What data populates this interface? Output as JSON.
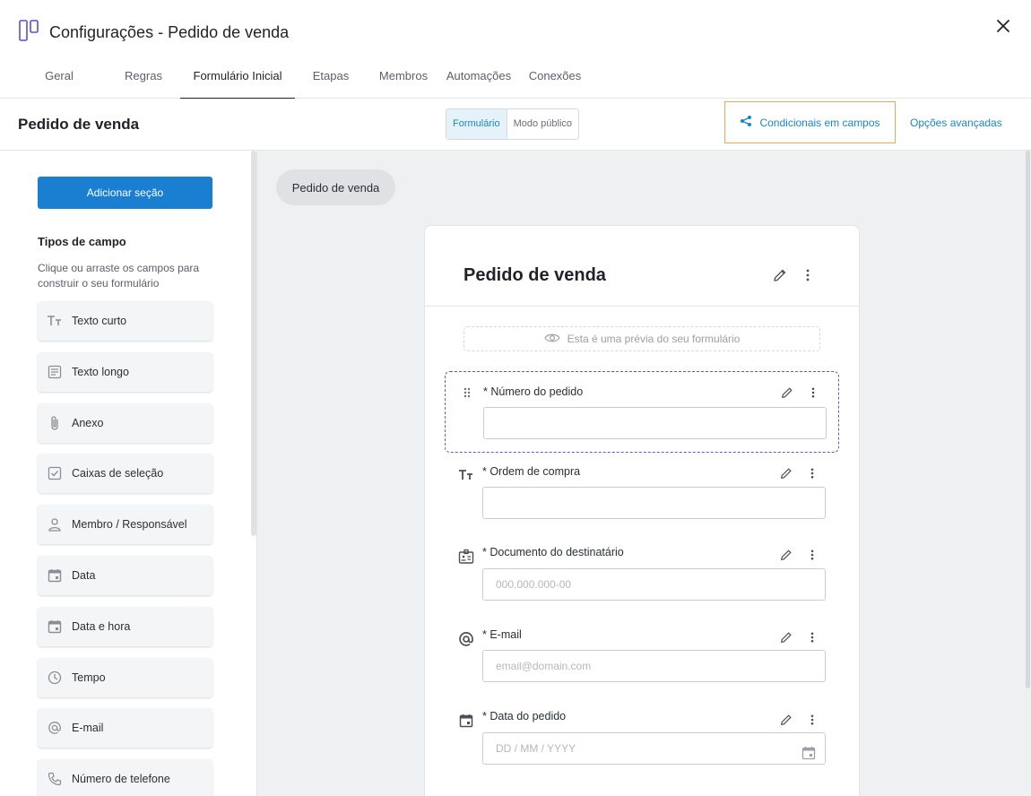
{
  "header": {
    "title": "Configurações - Pedido de venda",
    "tabs": [
      {
        "label": "Geral"
      },
      {
        "label": "Regras"
      },
      {
        "label": "Formulário Inicial"
      },
      {
        "label": "Etapas"
      },
      {
        "label": "Membros"
      },
      {
        "label": "Automações"
      },
      {
        "label": "Conexões"
      }
    ],
    "active_tab": "Formulário Inicial"
  },
  "subheader": {
    "title": "Pedido de venda",
    "mode_form": "Formulário",
    "mode_public": "Modo público",
    "conditionals": "Condicionais em campos",
    "advanced": "Opções avançadas"
  },
  "sidebar": {
    "add_section": "Adicionar seção",
    "types_title": "Tipos de campo",
    "types_help": "Clique ou arraste os campos para construir o seu formulário",
    "fields": [
      {
        "label": "Texto curto",
        "icon": "text-short-icon"
      },
      {
        "label": "Texto longo",
        "icon": "text-long-icon"
      },
      {
        "label": "Anexo",
        "icon": "paperclip-icon"
      },
      {
        "label": "Caixas de seleção",
        "icon": "checkbox-icon"
      },
      {
        "label": "Membro / Responsável",
        "icon": "person-icon"
      },
      {
        "label": "Data",
        "icon": "calendar-icon"
      },
      {
        "label": "Data e hora",
        "icon": "calendar-time-icon"
      },
      {
        "label": "Tempo",
        "icon": "clock-icon"
      },
      {
        "label": "E-mail",
        "icon": "at-icon"
      },
      {
        "label": "Número de telefone",
        "icon": "phone-icon"
      }
    ]
  },
  "canvas": {
    "section_chip": "Pedido de venda",
    "card_title": "Pedido de venda",
    "preview_note": "Esta é uma prévia do seu formulário",
    "questions": [
      {
        "label": "* Número do pedido",
        "placeholder": ""
      },
      {
        "label": "* Ordem de compra",
        "placeholder": ""
      },
      {
        "label": "* Documento do destinatário",
        "placeholder": "000.000.000-00"
      },
      {
        "label": "* E-mail",
        "placeholder": "email@domain.com"
      },
      {
        "label": "* Data do pedido",
        "placeholder": "DD / MM / YYYY"
      }
    ]
  },
  "colors": {
    "accent": "#1a86c4",
    "primary_button": "#1a7fd0",
    "highlight_border": "#f0a45d",
    "selected_dashed": "#5a5fbf"
  }
}
